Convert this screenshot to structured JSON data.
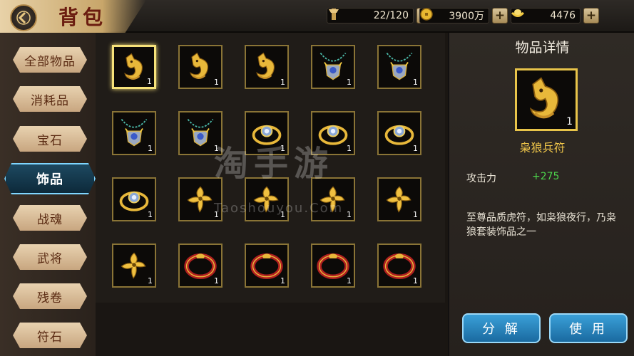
{
  "header": {
    "title": "背包",
    "resources": [
      {
        "icon": "bag-capacity-icon",
        "value": "22/120"
      },
      {
        "icon": "gold-coin-icon",
        "value": "3900万"
      },
      {
        "icon": "ingot-icon",
        "value": "4476"
      }
    ]
  },
  "sidebar": {
    "items": [
      {
        "label": "全部物品",
        "active": false
      },
      {
        "label": "消耗品",
        "active": false
      },
      {
        "label": "宝石",
        "active": false
      },
      {
        "label": "饰品",
        "active": true
      },
      {
        "label": "战魂",
        "active": false
      },
      {
        "label": "武将",
        "active": false
      },
      {
        "label": "残卷",
        "active": false
      },
      {
        "label": "符石",
        "active": false
      }
    ]
  },
  "inventory": {
    "items": [
      {
        "kind": "wolf-talisman",
        "qty": "1",
        "selected": true
      },
      {
        "kind": "wolf-talisman",
        "qty": "1"
      },
      {
        "kind": "wolf-talisman",
        "qty": "1"
      },
      {
        "kind": "necklace",
        "qty": "1"
      },
      {
        "kind": "necklace",
        "qty": "1"
      },
      {
        "kind": "necklace",
        "qty": "1"
      },
      {
        "kind": "necklace",
        "qty": "1"
      },
      {
        "kind": "ring",
        "qty": "1"
      },
      {
        "kind": "ring",
        "qty": "1"
      },
      {
        "kind": "ring",
        "qty": "1"
      },
      {
        "kind": "ring",
        "qty": "1"
      },
      {
        "kind": "gold-charm",
        "qty": "1"
      },
      {
        "kind": "gold-charm",
        "qty": "1"
      },
      {
        "kind": "gold-charm",
        "qty": "1"
      },
      {
        "kind": "gold-charm",
        "qty": "1"
      },
      {
        "kind": "gold-charm",
        "qty": "1"
      },
      {
        "kind": "red-bracelet",
        "qty": "1"
      },
      {
        "kind": "red-bracelet",
        "qty": "1"
      },
      {
        "kind": "red-bracelet",
        "qty": "1"
      },
      {
        "kind": "red-bracelet",
        "qty": "1"
      }
    ]
  },
  "detail": {
    "title": "物品详情",
    "qty": "1",
    "item_name": "枭狼兵符",
    "stat_label": "攻击力",
    "stat_value": "+275",
    "description": "至尊品质虎符，如枭狼夜行，乃枭狼套装饰品之一",
    "decompose_label": "分 解",
    "use_label": "使 用"
  },
  "watermark": {
    "main": "淘手游",
    "sub": "Taoshouyou.Com"
  },
  "colors": {
    "gold_border": "#8a7436",
    "selected_border": "#f6e27a",
    "item_name": "#f0c64a",
    "stat_value": "#4cd44c",
    "action_button": "#1a6aa0"
  }
}
